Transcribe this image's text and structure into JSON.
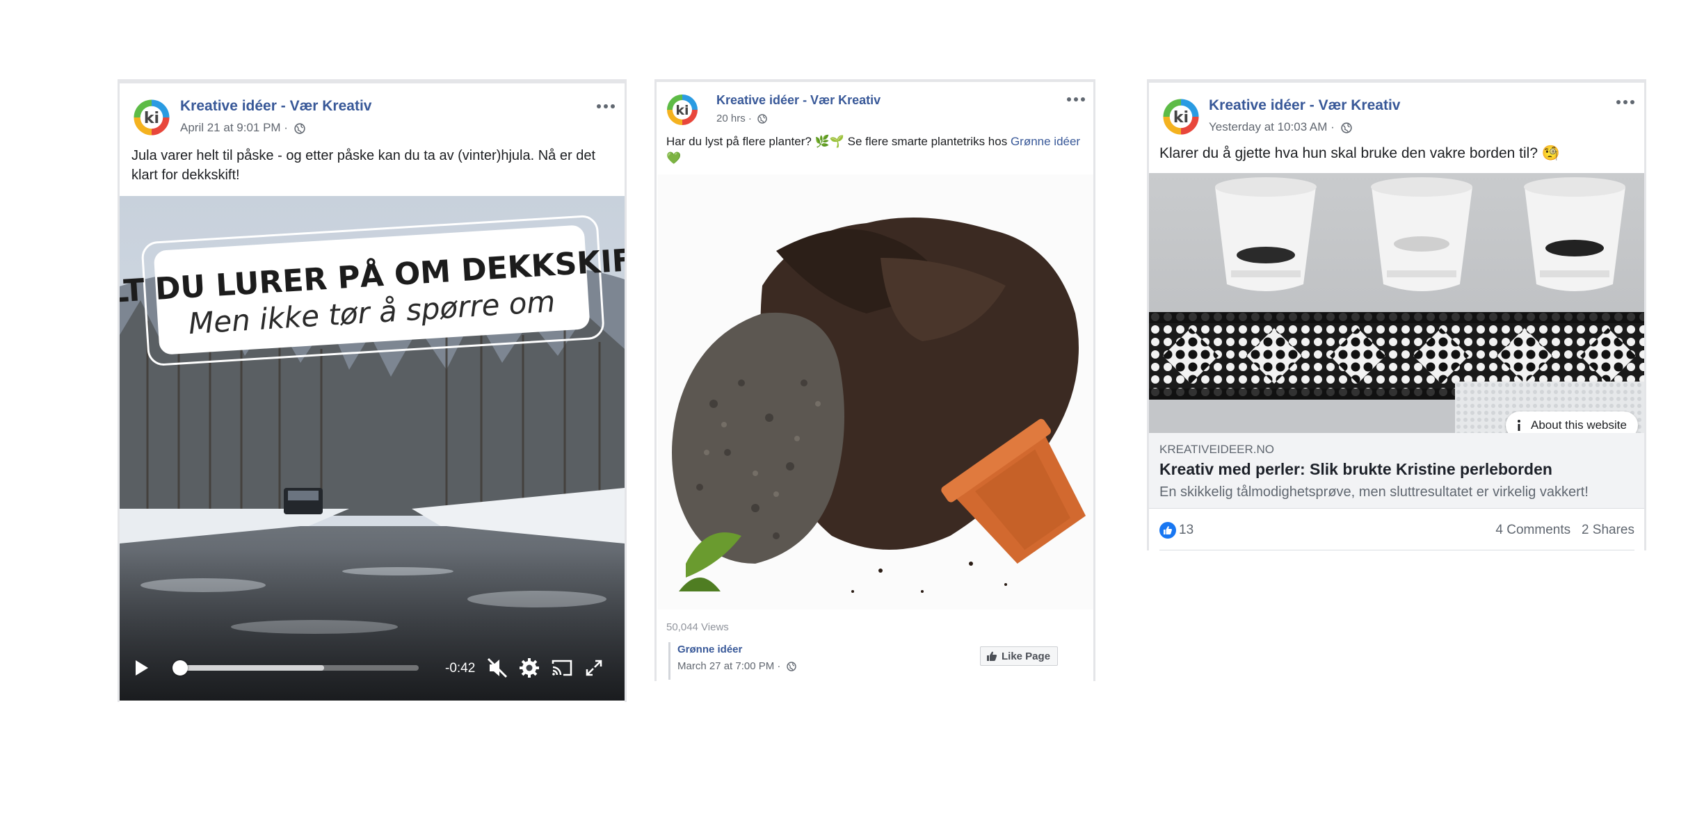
{
  "colors": {
    "link": "#385898",
    "meta": "#616770",
    "border": "#e4e5e8",
    "like_blue": "#1877f2"
  },
  "post1": {
    "page_name": "Kreative idéer - Vær Kreativ",
    "timestamp": "April 21 at 9:01 PM · ",
    "text": "Jula varer helt til påske - og etter påske kan du ta av (vinter)hjula. Nå er det klart for dekkskift!",
    "video": {
      "overlay_title": "ALT DU LURER PÅ OM DEKKSKIFT",
      "overlay_subtitle": "Men ikke tør å spørre om",
      "time_remaining": "-0:42",
      "buffered": 0.61,
      "played": 0.02,
      "icons": [
        "play-icon",
        "mute-icon",
        "gear-icon",
        "cast-icon",
        "fullscreen-icon"
      ]
    }
  },
  "post2": {
    "page_name": "Kreative idéer - Vær Kreativ",
    "timestamp": "20 hrs · ",
    "text_prefix": "Har du lyst på flere planter? 🌿🌱 Se flere smarte plantetriks hos ",
    "text_link": "Grønne idéer",
    "text_suffix": " 💚",
    "views": "50,044 Views",
    "shared_page": "Grønne idéer",
    "shared_time": "March 27 at 7:00 PM · ",
    "like_page_label": "Like Page"
  },
  "post3": {
    "page_name": "Kreative idéer - Vær Kreativ",
    "timestamp": "Yesterday at 10:03 AM · ",
    "text": "Klarer du å gjette hva hun skal bruke den vakre borden til? 🧐",
    "about_label": "About this website",
    "link_domain": "KREATIVEIDEER.NO",
    "link_title": "Kreativ med perler: Slik brukte Kristine perleborden",
    "link_desc": "En skikkelig tålmodighetsprøve, men sluttresultatet er virkelig vakkert!",
    "likes": "13",
    "comments": "4 Comments",
    "shares": "2 Shares"
  }
}
